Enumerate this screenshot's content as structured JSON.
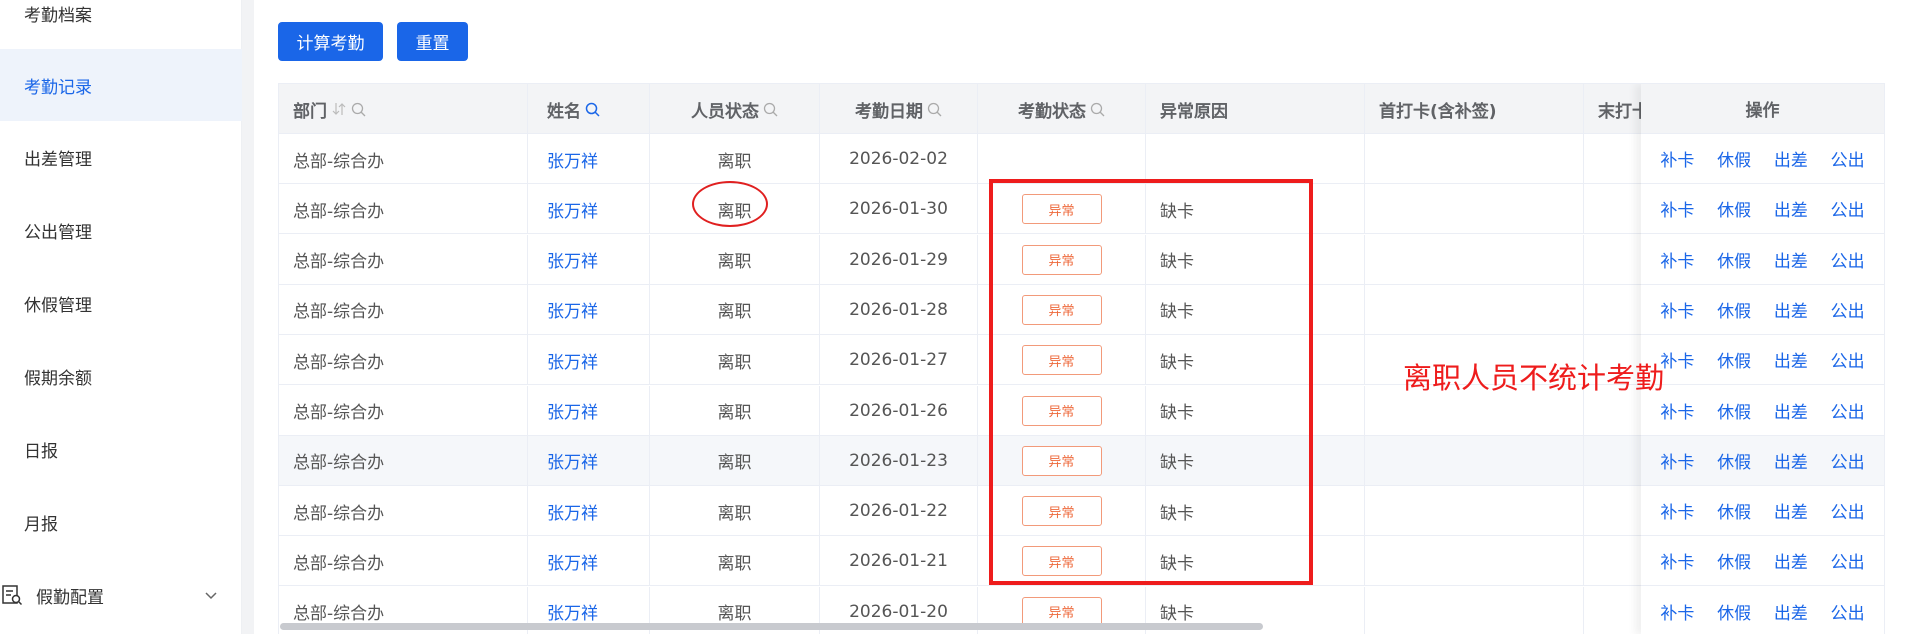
{
  "sidebar": {
    "items": [
      {
        "label": "考勤档案",
        "active": false
      },
      {
        "label": "考勤记录",
        "active": true
      },
      {
        "label": "出差管理",
        "active": false
      },
      {
        "label": "公出管理",
        "active": false
      },
      {
        "label": "休假管理",
        "active": false
      },
      {
        "label": "假期余额",
        "active": false
      },
      {
        "label": "日报",
        "active": false
      },
      {
        "label": "月报",
        "active": false
      }
    ],
    "group": {
      "label": "假勤配置",
      "icon": "config-list-icon",
      "chevron": "chevron-down-icon"
    }
  },
  "toolbar": {
    "calculate_label": "计算考勤",
    "reset_label": "重置"
  },
  "table": {
    "columns": {
      "dept": "部门",
      "name": "姓名",
      "status": "人员状态",
      "date": "考勤日期",
      "att_status": "考勤状态",
      "reason": "异常原因",
      "first_punch": "首打卡(含补签)",
      "last_punch": "末打卡",
      "ops": "操作"
    },
    "op_labels": {
      "bk": "补卡",
      "xj": "休假",
      "cc": "出差",
      "gc": "公出"
    },
    "rows": [
      {
        "dept": "总部-综合办",
        "name": "张万祥",
        "status": "离职",
        "date": "2026-02-02",
        "att_status": "",
        "reason": ""
      },
      {
        "dept": "总部-综合办",
        "name": "张万祥",
        "status": "离职",
        "date": "2026-01-30",
        "att_status": "异常",
        "reason": "缺卡"
      },
      {
        "dept": "总部-综合办",
        "name": "张万祥",
        "status": "离职",
        "date": "2026-01-29",
        "att_status": "异常",
        "reason": "缺卡"
      },
      {
        "dept": "总部-综合办",
        "name": "张万祥",
        "status": "离职",
        "date": "2026-01-28",
        "att_status": "异常",
        "reason": "缺卡"
      },
      {
        "dept": "总部-综合办",
        "name": "张万祥",
        "status": "离职",
        "date": "2026-01-27",
        "att_status": "异常",
        "reason": "缺卡"
      },
      {
        "dept": "总部-综合办",
        "name": "张万祥",
        "status": "离职",
        "date": "2026-01-26",
        "att_status": "异常",
        "reason": "缺卡"
      },
      {
        "dept": "总部-综合办",
        "name": "张万祥",
        "status": "离职",
        "date": "2026-01-23",
        "att_status": "异常",
        "reason": "缺卡"
      },
      {
        "dept": "总部-综合办",
        "name": "张万祥",
        "status": "离职",
        "date": "2026-01-22",
        "att_status": "异常",
        "reason": "缺卡"
      },
      {
        "dept": "总部-综合办",
        "name": "张万祥",
        "status": "离职",
        "date": "2026-01-21",
        "att_status": "异常",
        "reason": "缺卡"
      },
      {
        "dept": "总部-综合办",
        "name": "张万祥",
        "status": "离职",
        "date": "2026-01-20",
        "att_status": "异常",
        "reason": "缺卡"
      }
    ]
  },
  "annotation": {
    "text": "离职人员不统计考勤"
  },
  "colors": {
    "primary": "#1a66e8",
    "annotation_red": "#ee1c1c",
    "tag_orange": "#ee6a3c"
  }
}
